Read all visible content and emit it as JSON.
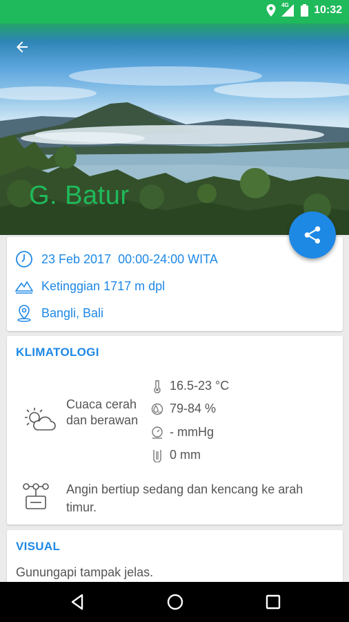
{
  "status_bar": {
    "time": "10:32",
    "network": "4G"
  },
  "header": {
    "title": "G. Batur"
  },
  "info": {
    "date_time": "23 Feb 2017  00:00-24:00 WITA",
    "elevation": "Ketinggian 1717 m dpl",
    "location": "Bangli, Bali"
  },
  "climatology": {
    "title": "KLIMATOLOGI",
    "condition": "Cuaca cerah dan berawan",
    "temperature": "16.5-23 °C",
    "humidity": "79-84 %",
    "pressure": "- mmHg",
    "rainfall": "0 mm",
    "wind": "Angin bertiup sedang dan kencang ke arah timur."
  },
  "visual": {
    "title": "VISUAL",
    "description": "Gunungapi tampak jelas."
  },
  "colors": {
    "accent": "#1e88e5",
    "brand_green": "#1fba5b",
    "text_gray": "#555555"
  }
}
